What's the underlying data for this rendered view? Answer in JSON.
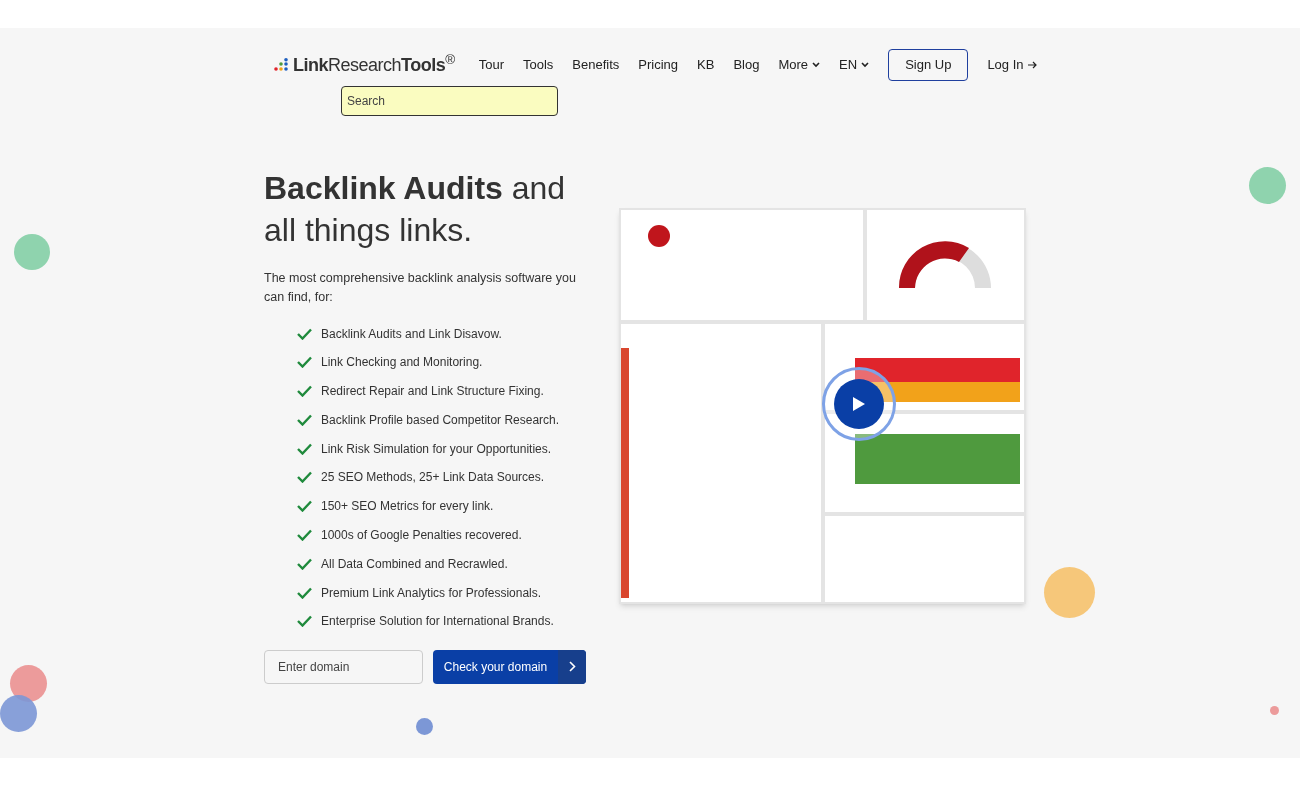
{
  "header": {
    "logo": "**Link**Research**Tools**$^{®}$",
    "nav": [
      {
        "label": "Tour",
        "kind": "link"
      },
      {
        "label": "Tools",
        "kind": "link"
      },
      {
        "label": "Benefits",
        "kind": "link"
      },
      {
        "label": "Pricing",
        "kind": "link"
      },
      {
        "label": "KB",
        "kind": "link"
      },
      {
        "label": "Blog",
        "kind": "link"
      },
      {
        "label": "More",
        "kind": "dropdown"
      },
      {
        "label": "EN",
        "kind": "dropdown"
      },
      {
        "label": "Sign Up",
        "kind": "outline"
      },
      {
        "label": "Log In",
        "kind": "arrow"
      }
    ],
    "search": {
      "placeholder": "Search"
    }
  },
  "hero": {
    "title": "**Backlink Audits** and all things links.",
    "intro": "The most comprehensive backlink analysis software you can find, for:",
    "features": [
      "Backlink Audits and Link Disavow.",
      "Link Checking and Monitoring.",
      "Redirect Repair and Link Structure Fixing.",
      "Backlink Profile based Competitor Research.",
      "Link Risk Simulation for your Opportunities.",
      "25 SEO Methods, 25+ Link Data Sources.",
      "150+ SEO Metrics for every link.",
      "1000s of Google Penalties recovered.",
      "All Data Combined and Recrawled.",
      "Premium Link Analytics for Professionals.",
      "Enterprise Solution for International Brands."
    ],
    "domain_field": {
      "placeholder": "Enter domain"
    },
    "cta": "Check your domain"
  }
}
